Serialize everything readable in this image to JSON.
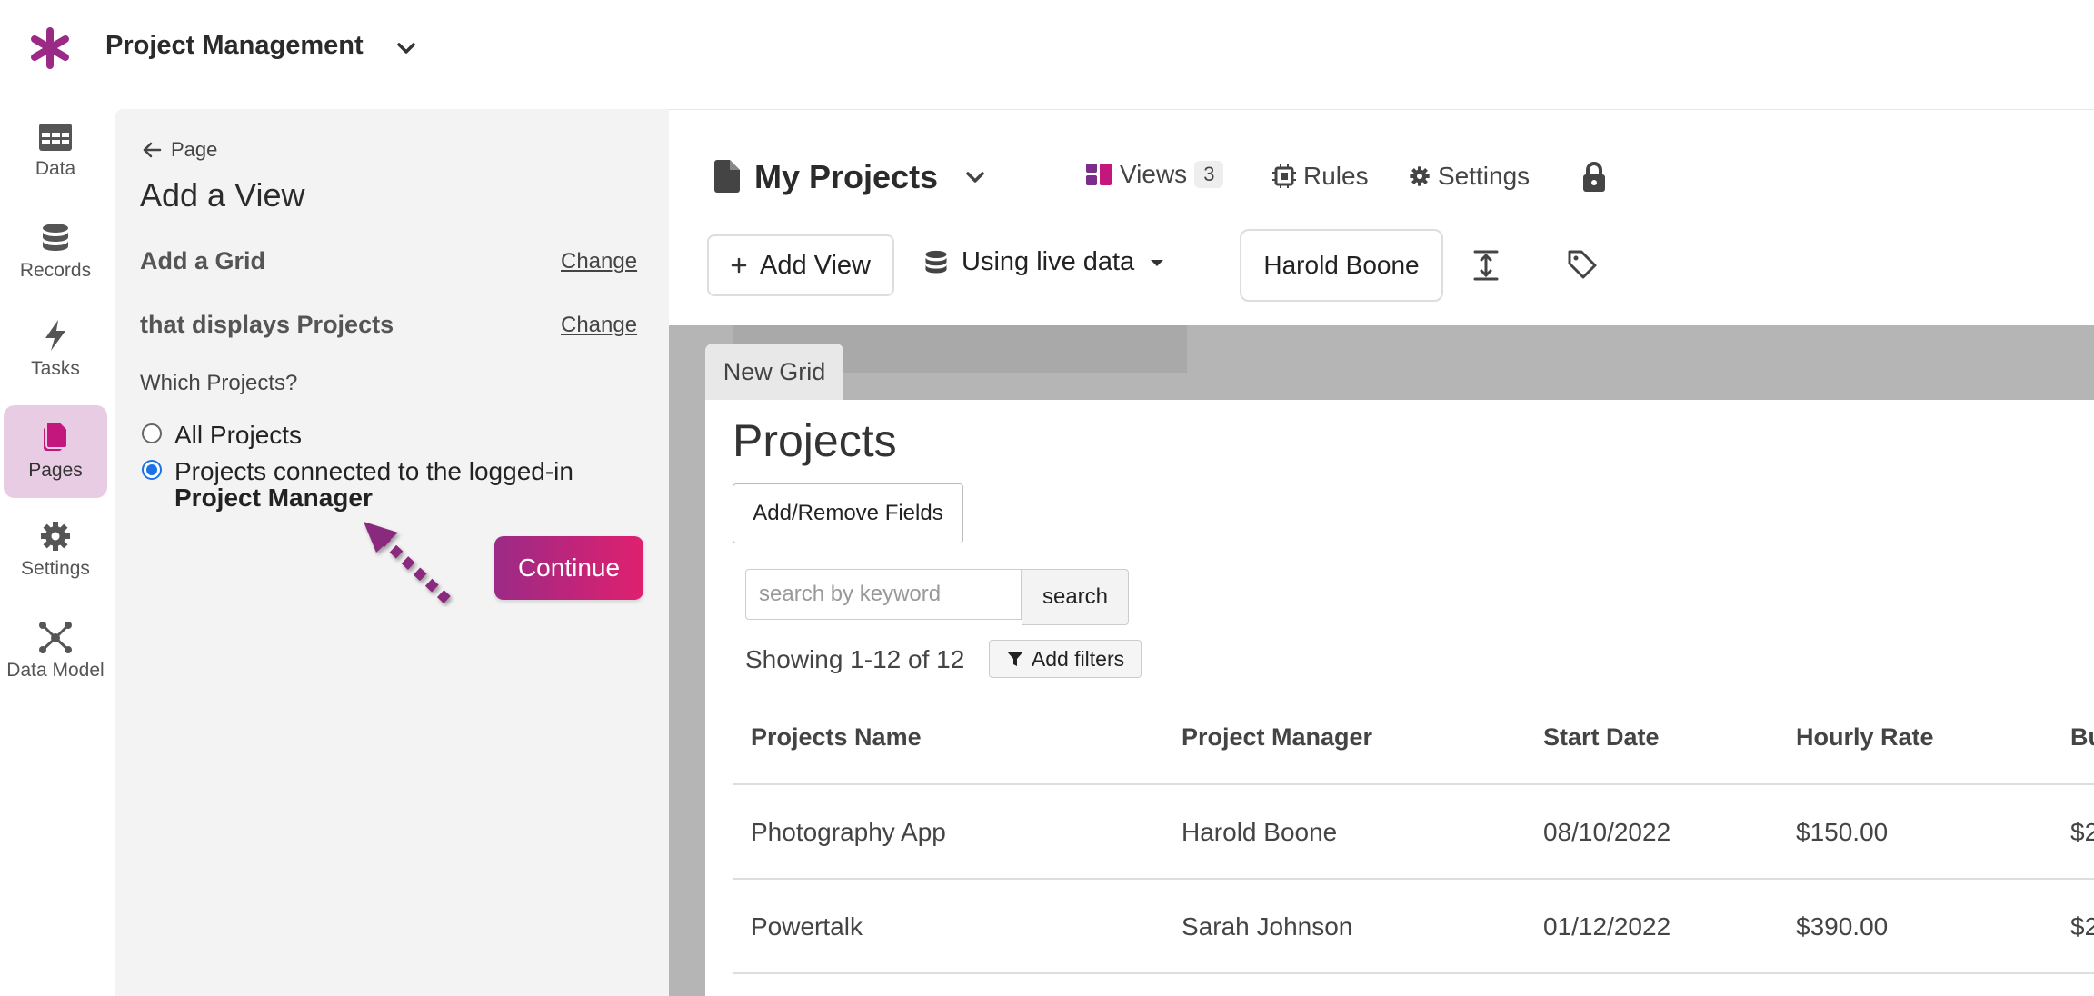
{
  "app": {
    "title": "Project Management"
  },
  "nav": {
    "items": [
      {
        "label": "Data",
        "icon": "table-icon"
      },
      {
        "label": "Records",
        "icon": "database-icon"
      },
      {
        "label": "Tasks",
        "icon": "bolt-icon"
      },
      {
        "label": "Pages",
        "icon": "pages-icon",
        "active": true
      },
      {
        "label": "Settings",
        "icon": "gear-icon"
      },
      {
        "label": "Data Model",
        "icon": "network-icon"
      }
    ]
  },
  "panel": {
    "back_label": "Page",
    "title": "Add a View",
    "rows": [
      {
        "label": "Add a Grid",
        "action": "Change"
      },
      {
        "label": "that displays Projects",
        "action": "Change"
      }
    ],
    "question": "Which Projects?",
    "options": [
      {
        "label": "All Projects",
        "selected": false
      },
      {
        "label": "Projects connected to the logged-in",
        "label_bold": "Project Manager",
        "selected": true
      }
    ],
    "continue_label": "Continue"
  },
  "header": {
    "page_name": "My Projects",
    "views_label": "Views",
    "views_count": "3",
    "rules_label": "Rules",
    "settings_label": "Settings",
    "add_view_label": "Add View",
    "live_data_label": "Using live data",
    "user_name": "Harold Boone"
  },
  "grid": {
    "tab_label": "New Grid",
    "title": "Projects",
    "fields_button": "Add/Remove Fields",
    "search_placeholder": "search by keyword",
    "search_button": "search",
    "showing": "Showing 1-12 of 12",
    "filters_button": "Add filters",
    "columns": [
      "Projects Name",
      "Project Manager",
      "Start Date",
      "Hourly Rate",
      "Bu"
    ],
    "rows": [
      [
        "Photography App",
        "Harold Boone",
        "08/10/2022",
        "$150.00",
        "$2"
      ],
      [
        "Powertalk",
        "Sarah Johnson",
        "01/12/2022",
        "$390.00",
        "$2"
      ]
    ]
  },
  "colors": {
    "brand": "#9b2a86",
    "accent": "#e0206f",
    "radio": "#1a73e8"
  }
}
